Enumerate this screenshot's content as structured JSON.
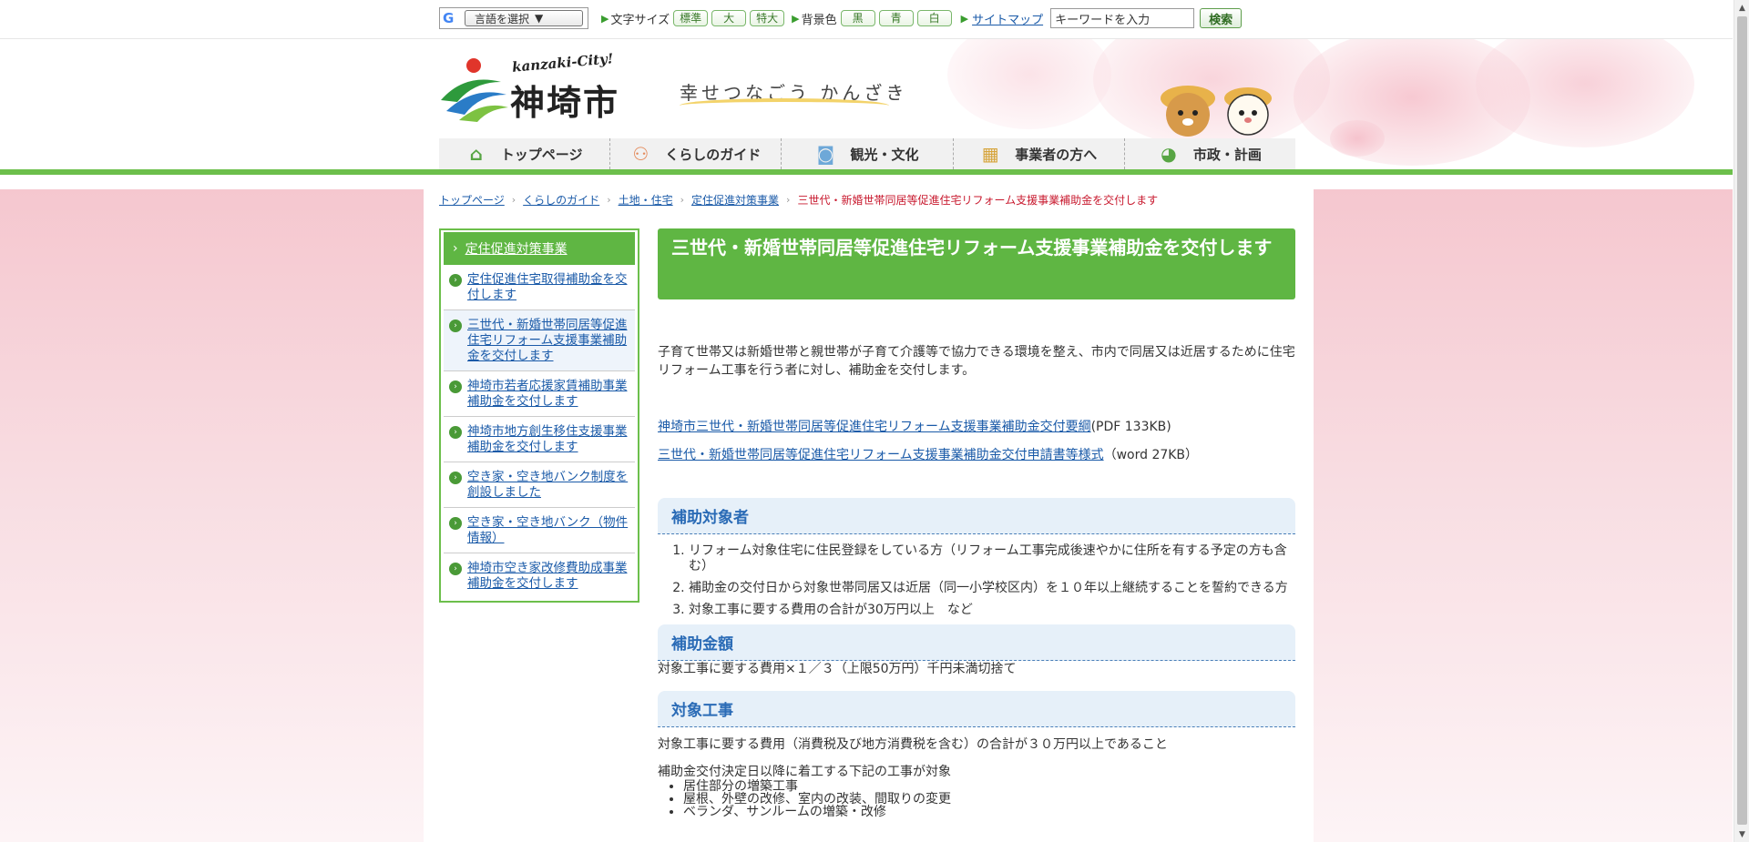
{
  "utility": {
    "translate_label": "言語を選択",
    "translate_arrow": "▼",
    "font_size_label": "文字サイズ",
    "font_size_options": [
      "標準",
      "大",
      "特大"
    ],
    "bg_color_label": "背景色",
    "bg_color_options": [
      "黒",
      "青",
      "白"
    ],
    "sitemap_label": "サイトマップ",
    "search_placeholder": "キーワードを入力",
    "search_button": "検索"
  },
  "logo": {
    "sub_text": "kanzaki-City!",
    "main_text": "神埼市"
  },
  "tagline": "幸せつなごう かんざき",
  "global_nav": [
    {
      "label": "トップページ",
      "icon": "home-icon"
    },
    {
      "label": "くらしのガイド",
      "icon": "people-icon"
    },
    {
      "label": "観光・文化",
      "icon": "camera-icon"
    },
    {
      "label": "事業者の方へ",
      "icon": "building-icon"
    },
    {
      "label": "市政・計画",
      "icon": "city-mark-icon"
    }
  ],
  "breadcrumb": {
    "items": [
      "トップページ",
      "くらしのガイド",
      "土地・住宅",
      "定住促進対策事業"
    ],
    "current": "三世代・新婚世帯同居等促進住宅リフォーム支援事業補助金を交付します"
  },
  "sidenav": {
    "heading": "定住促進対策事業",
    "items": [
      "定住促進住宅取得補助金を交付します",
      "三世代・新婚世帯同居等促進住宅リフォーム支援事業補助金を交付します",
      "神埼市若者応援家賃補助事業補助金を交付します",
      "神埼市地方創生移住支援事業補助金を交付します",
      "空き家・空き地バンク制度を創設しました",
      "空き家・空き地バンク（物件情報）",
      "神埼市空き家改修費助成事業補助金を交付します"
    ]
  },
  "main": {
    "title": "三世代・新婚世帯同居等促進住宅リフォーム支援事業補助金を交付します",
    "intro": "子育て世帯又は新婚世帯と親世帯が子育て介護等で協力できる環境を整え、市内で同居又は近居するために住宅リフォーム工事を行う者に対し、補助金を交付します。",
    "downloads": [
      {
        "link": "神埼市三世代・新婚世帯同居等促進住宅リフォーム支援事業補助金交付要綱",
        "meta": "(PDF 133KB)"
      },
      {
        "link": "三世代・新婚世帯同居等促進住宅リフォーム支援事業補助金交付申請書等様式",
        "meta": "（word 27KB）"
      }
    ],
    "section_targets": {
      "heading": "補助対象者",
      "items": [
        "リフォーム対象住宅に住民登録をしている方（リフォーム工事完成後速やかに住所を有する予定の方も含む）",
        "補助金の交付日から対象世帯同居又は近居（同一小学校区内）を１０年以上継続することを誓約できる方",
        "対象工事に要する費用の合計が30万円以上　など"
      ]
    },
    "section_amount": {
      "heading": "補助金額",
      "text": "対象工事に要する費用×１／３（上限50万円）千円未満切捨て"
    },
    "section_works": {
      "heading": "対象工事",
      "text": "対象工事に要する費用（消費税及び地方消費税を含む）の合計が３０万円以上であること",
      "list_intro": "補助金交付決定日以降に着工する下記の工事が対象",
      "items": [
        "居住部分の増築工事",
        "屋根、外壁の改修、室内の改装、間取りの変更",
        "ベランダ、サンルームの増築・改修"
      ]
    }
  }
}
